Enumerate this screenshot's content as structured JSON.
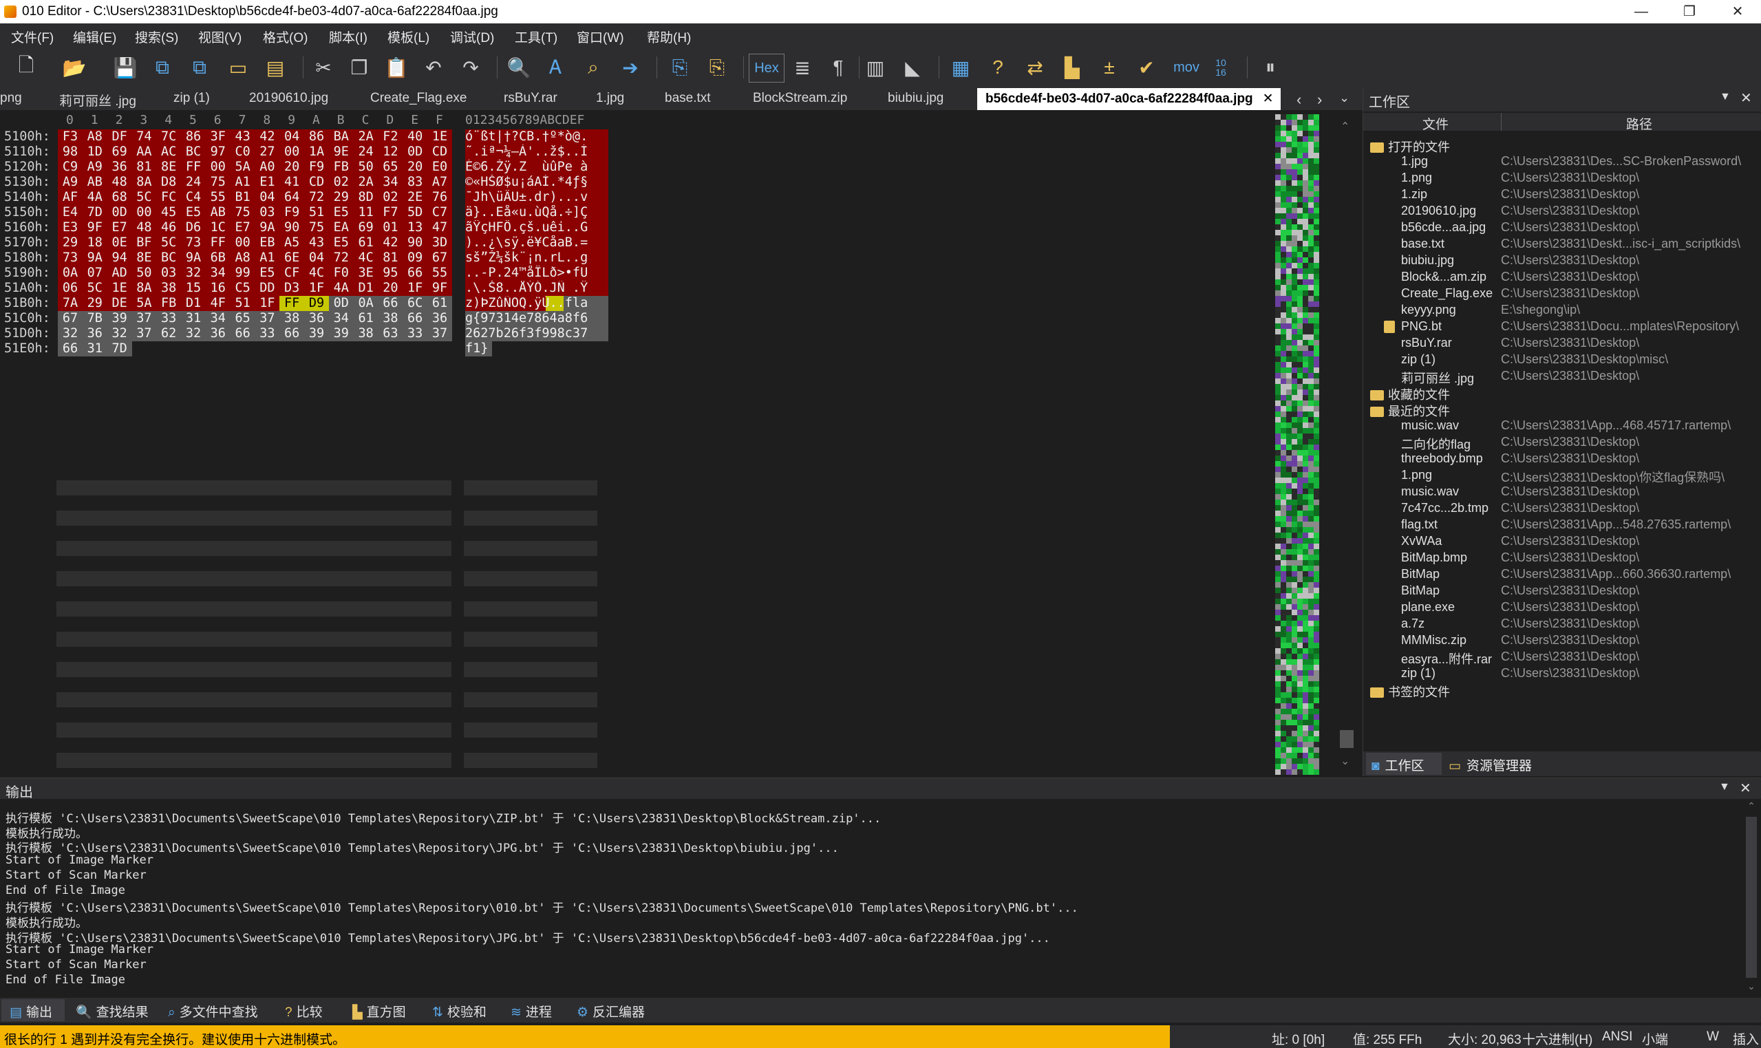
{
  "window": {
    "title": "010 Editor - C:\\Users\\23831\\Desktop\\b56cde4f-be03-4d07-a0ca-6af22284f0aa.jpg"
  },
  "menu": [
    "文件(F)",
    "编辑(E)",
    "搜索(S)",
    "视图(V)",
    "格式(O)",
    "脚本(I)",
    "模板(L)",
    "调试(D)",
    "工具(T)",
    "窗口(W)",
    "帮助(H)"
  ],
  "toolbar": {
    "hex_label": "Hex",
    "mov_label": "mov",
    "num_label": "10\n16"
  },
  "tabs": [
    "png",
    "莉可丽丝 .jpg",
    "zip (1)",
    "20190610.jpg",
    "Create_Flag.exe",
    "rsBuY.rar",
    "1.jpg",
    "base.txt",
    "BlockStream.zip",
    "biubiu.jpg"
  ],
  "active_tab": "b56cde4f-be03-4d07-a0ca-6af22284f0aa.jpg",
  "hex": {
    "column_header": [
      "0",
      "1",
      "2",
      "3",
      "4",
      "5",
      "6",
      "7",
      "8",
      "9",
      "A",
      "B",
      "C",
      "D",
      "E",
      "F"
    ],
    "ascii_header": "0123456789ABCDEF",
    "rows": [
      {
        "addr": "5100h:",
        "bytes": [
          "F3",
          "A8",
          "DF",
          "74",
          "7C",
          "86",
          "3F",
          "43",
          "42",
          "04",
          "86",
          "BA",
          "2A",
          "F2",
          "40",
          "1E"
        ],
        "ascii": "ó¨ßt|†?CB.†º*ò@."
      },
      {
        "addr": "5110h:",
        "bytes": [
          "98",
          "1D",
          "69",
          "AA",
          "AC",
          "BC",
          "97",
          "C0",
          "27",
          "00",
          "1A",
          "9E",
          "24",
          "12",
          "0D",
          "CD"
        ],
        "ascii": "˜.iª¬¼—À'..ž$..Í"
      },
      {
        "addr": "5120h:",
        "bytes": [
          "C9",
          "A9",
          "36",
          "81",
          "8E",
          "FF",
          "00",
          "5A",
          "A0",
          "20",
          "F9",
          "FB",
          "50",
          "65",
          "20",
          "E0"
        ],
        "ascii": "É©6.Žÿ.Z  ùûPe à"
      },
      {
        "addr": "5130h:",
        "bytes": [
          "A9",
          "AB",
          "48",
          "8A",
          "D8",
          "24",
          "75",
          "A1",
          "E1",
          "41",
          "CD",
          "02",
          "2A",
          "34",
          "83",
          "A7"
        ],
        "ascii": "©«HŠØ$u¡áAÍ.*4ƒ§"
      },
      {
        "addr": "5140h:",
        "bytes": [
          "AF",
          "4A",
          "68",
          "5C",
          "FC",
          "C4",
          "55",
          "B1",
          "04",
          "64",
          "72",
          "29",
          "8D",
          "02",
          "2E",
          "76"
        ],
        "ascii": "¯Jh\\üÄU±.dr)...v"
      },
      {
        "addr": "5150h:",
        "bytes": [
          "E4",
          "7D",
          "0D",
          "00",
          "45",
          "E5",
          "AB",
          "75",
          "03",
          "F9",
          "51",
          "E5",
          "11",
          "F7",
          "5D",
          "C7"
        ],
        "ascii": "ä}..Eå«u.ùQå.÷]Ç"
      },
      {
        "addr": "5160h:",
        "bytes": [
          "E3",
          "9F",
          "E7",
          "48",
          "46",
          "D6",
          "1C",
          "E7",
          "9A",
          "90",
          "75",
          "EA",
          "69",
          "01",
          "13",
          "47"
        ],
        "ascii": "ãŸçHFÖ.çš.uêi..G"
      },
      {
        "addr": "5170h:",
        "bytes": [
          "29",
          "18",
          "0E",
          "BF",
          "5C",
          "73",
          "FF",
          "00",
          "EB",
          "A5",
          "43",
          "E5",
          "61",
          "42",
          "90",
          "3D"
        ],
        "ascii": ")..¿\\sÿ.ë¥CåaB.="
      },
      {
        "addr": "5180h:",
        "bytes": [
          "73",
          "9A",
          "94",
          "8E",
          "BC",
          "9A",
          "6B",
          "A8",
          "A1",
          "6E",
          "04",
          "72",
          "4C",
          "81",
          "09",
          "67"
        ],
        "ascii": "sš”Ž¼šk¨¡n.rL..g"
      },
      {
        "addr": "5190h:",
        "bytes": [
          "0A",
          "07",
          "AD",
          "50",
          "03",
          "32",
          "34",
          "99",
          "E5",
          "CF",
          "4C",
          "F0",
          "3E",
          "95",
          "66",
          "55"
        ],
        "ascii": "..-P.24™åÏLð>•fU"
      },
      {
        "addr": "51A0h:",
        "bytes": [
          "06",
          "5C",
          "1E",
          "8A",
          "38",
          "15",
          "16",
          "C5",
          "DD",
          "D3",
          "1F",
          "4A",
          "D1",
          "20",
          "1F",
          "9F"
        ],
        "ascii": ".\\.Š8..ÅÝÓ.JÑ .Ÿ"
      },
      {
        "addr": "51B0h:",
        "bytes": [
          "7A",
          "29",
          "DE",
          "5A",
          "FB",
          "D1",
          "4F",
          "51",
          "1F",
          "FF",
          "D9",
          "0D",
          "0A",
          "66",
          "6C",
          "61"
        ],
        "ascii": "z)ÞZûÑOQ.ÿÙ..fla"
      },
      {
        "addr": "51C0h:",
        "bytes": [
          "67",
          "7B",
          "39",
          "37",
          "33",
          "31",
          "34",
          "65",
          "37",
          "38",
          "36",
          "34",
          "61",
          "38",
          "66",
          "36"
        ],
        "ascii": "g{97314e7864a8f6"
      },
      {
        "addr": "51D0h:",
        "bytes": [
          "32",
          "36",
          "32",
          "37",
          "62",
          "32",
          "36",
          "66",
          "33",
          "66",
          "39",
          "39",
          "38",
          "63",
          "33",
          "37"
        ],
        "ascii": "2627b26f3f998c37"
      },
      {
        "addr": "51E0h:",
        "bytes": [
          "66",
          "31",
          "7D"
        ],
        "ascii": "f1}"
      }
    ]
  },
  "workspace": {
    "title": "工作区",
    "col_file": "文件",
    "col_path": "路径",
    "groups": {
      "open": "打开的文件",
      "fav": "收藏的文件",
      "recent": "最近的文件",
      "bookmark": "书签的文件"
    },
    "open_files": [
      {
        "name": "1.jpg",
        "path": "C:\\Users\\23831\\Des...SC-BrokenPassword\\"
      },
      {
        "name": "1.png",
        "path": "C:\\Users\\23831\\Desktop\\"
      },
      {
        "name": "1.zip",
        "path": "C:\\Users\\23831\\Desktop\\"
      },
      {
        "name": "20190610.jpg",
        "path": "C:\\Users\\23831\\Desktop\\"
      },
      {
        "name": "b56cde...aa.jpg",
        "path": "C:\\Users\\23831\\Desktop\\"
      },
      {
        "name": "base.txt",
        "path": "C:\\Users\\23831\\Deskt...isc-i_am_scriptkids\\"
      },
      {
        "name": "biubiu.jpg",
        "path": "C:\\Users\\23831\\Desktop\\"
      },
      {
        "name": "Block&...am.zip",
        "path": "C:\\Users\\23831\\Desktop\\"
      },
      {
        "name": "Create_Flag.exe",
        "path": "C:\\Users\\23831\\Desktop\\"
      },
      {
        "name": "keyyy.png",
        "path": "E:\\shegong\\ip\\"
      },
      {
        "name": "PNG.bt",
        "path": "C:\\Users\\23831\\Docu...mplates\\Repository\\"
      },
      {
        "name": "rsBuY.rar",
        "path": "C:\\Users\\23831\\Desktop\\"
      },
      {
        "name": "zip (1)",
        "path": "C:\\Users\\23831\\Desktop\\misc\\"
      },
      {
        "name": "莉可丽丝 .jpg",
        "path": "C:\\Users\\23831\\Desktop\\"
      }
    ],
    "recent_files": [
      {
        "name": "music.wav",
        "path": "C:\\Users\\23831\\App...468.45717.rartemp\\"
      },
      {
        "name": "二向化的flag",
        "path": "C:\\Users\\23831\\Desktop\\"
      },
      {
        "name": "threebody.bmp",
        "path": "C:\\Users\\23831\\Desktop\\"
      },
      {
        "name": "1.png",
        "path": "C:\\Users\\23831\\Desktop\\你这flag保熟吗\\"
      },
      {
        "name": "music.wav",
        "path": "C:\\Users\\23831\\Desktop\\"
      },
      {
        "name": "7c47cc...2b.tmp",
        "path": "C:\\Users\\23831\\Desktop\\"
      },
      {
        "name": "flag.txt",
        "path": "C:\\Users\\23831\\App...548.27635.rartemp\\"
      },
      {
        "name": "XvWAa",
        "path": "C:\\Users\\23831\\Desktop\\"
      },
      {
        "name": "BitMap.bmp",
        "path": "C:\\Users\\23831\\Desktop\\"
      },
      {
        "name": "BitMap",
        "path": "C:\\Users\\23831\\App...660.36630.rartemp\\"
      },
      {
        "name": "BitMap",
        "path": "C:\\Users\\23831\\Desktop\\"
      },
      {
        "name": "plane.exe",
        "path": "C:\\Users\\23831\\Desktop\\"
      },
      {
        "name": "a.7z",
        "path": "C:\\Users\\23831\\Desktop\\"
      },
      {
        "name": "MMMisc.zip",
        "path": "C:\\Users\\23831\\Desktop\\"
      },
      {
        "name": "easyra...附件.rar",
        "path": "C:\\Users\\23831\\Desktop\\"
      },
      {
        "name": "zip (1)",
        "path": "C:\\Users\\23831\\Desktop\\"
      }
    ],
    "bottom_tabs": {
      "workspace": "工作区",
      "explorer": "资源管理器"
    }
  },
  "output": {
    "title": "输出",
    "lines": [
      "执行模板 'C:\\Users\\23831\\Documents\\SweetScape\\010 Templates\\Repository\\ZIP.bt' 于 'C:\\Users\\23831\\Desktop\\Block&Stream.zip'...",
      "模板执行成功。",
      "执行模板 'C:\\Users\\23831\\Documents\\SweetScape\\010 Templates\\Repository\\JPG.bt' 于 'C:\\Users\\23831\\Desktop\\biubiu.jpg'...",
      "Start of Image Marker",
      "Start of Scan Marker",
      "End of File Image",
      "执行模板 'C:\\Users\\23831\\Documents\\SweetScape\\010 Templates\\Repository\\010.bt' 于 'C:\\Users\\23831\\Documents\\SweetScape\\010 Templates\\Repository\\PNG.bt'...",
      "模板执行成功。",
      "执行模板 'C:\\Users\\23831\\Documents\\SweetScape\\010 Templates\\Repository\\JPG.bt' 于 'C:\\Users\\23831\\Desktop\\b56cde4f-be03-4d07-a0ca-6af22284f0aa.jpg'...",
      "Start of Image Marker",
      "Start of Scan Marker",
      "End of File Image"
    ]
  },
  "bottom_tabs": [
    "输出",
    "查找结果",
    "多文件中查找",
    "比较",
    "直方图",
    "校验和",
    "进程",
    "反汇编器"
  ],
  "status": {
    "warning": "很长的行 1 遇到并没有完全换行。建议使用十六进制模式。",
    "address": "址: 0 [0h]",
    "value": "值: 255 FFh",
    "size": "大小: 20,963",
    "mode": "十六进制(H)",
    "encoding": "ANSI",
    "endian": "小端",
    "w": "W",
    "insert": "插入"
  },
  "colors": {
    "template_red": "#8b0000",
    "selection_yellow": "#c8c800",
    "tail_gray": "#5a5a5a",
    "accent": "#5aa8e8",
    "warning_bg": "#f4b400"
  }
}
